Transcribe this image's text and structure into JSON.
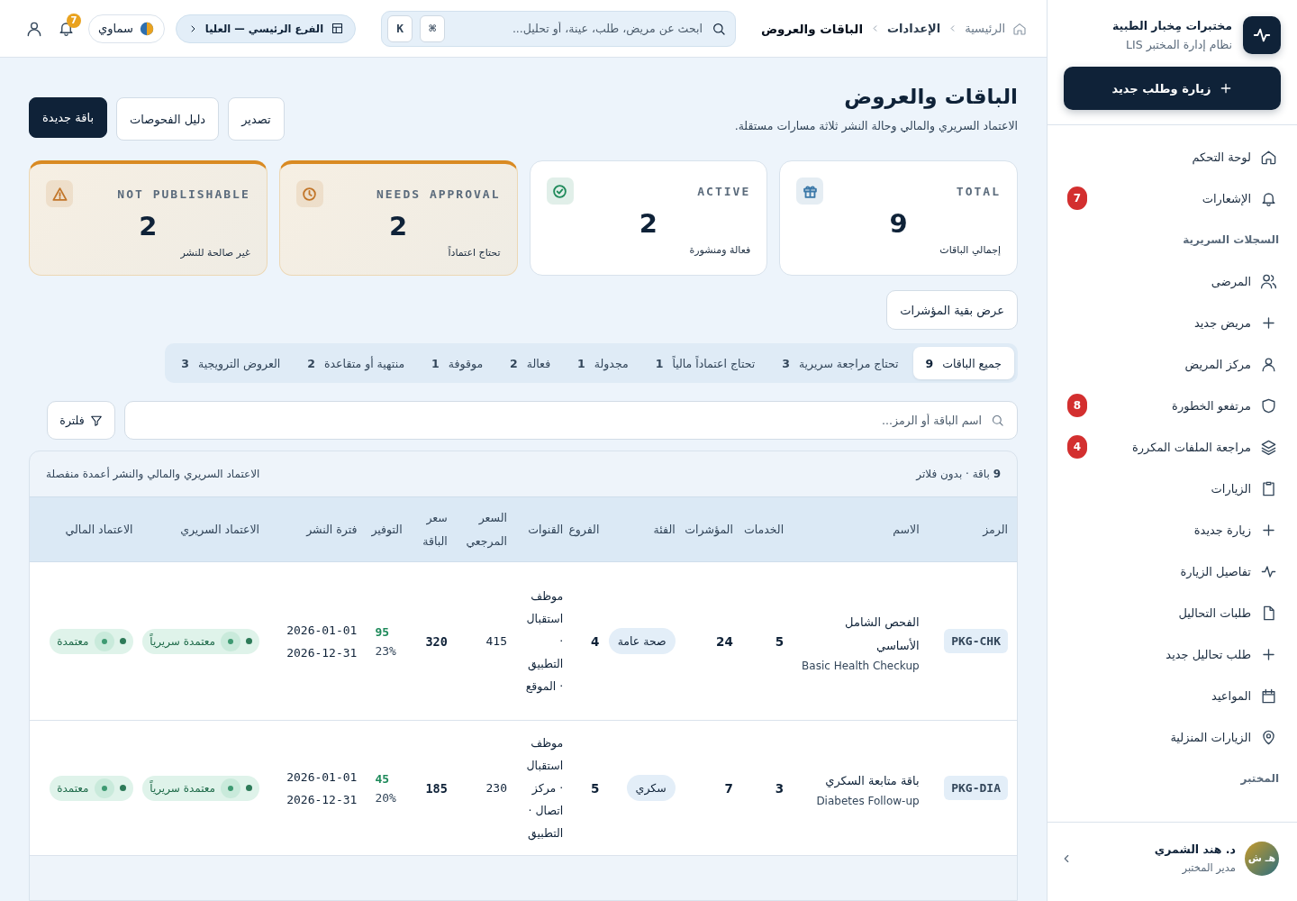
{
  "sidebar": {
    "brand": {
      "title": "مختبرات مِخبار الطبية",
      "subtitle": "نظام إدارة المختبر LIS"
    },
    "primary_button": "زيارة وطلب جديد",
    "items": [
      {
        "kind": "item",
        "label": "لوحة التحكم",
        "selected": false
      },
      {
        "kind": "item",
        "label": "الإشعارات",
        "selected": false,
        "badge": "7"
      },
      {
        "kind": "heading",
        "label": "السجلات السريرية"
      },
      {
        "kind": "item",
        "label": "المرضى",
        "selected": false
      },
      {
        "kind": "item",
        "label": "مريض جديد",
        "selected": false
      },
      {
        "kind": "item",
        "label": "مركز المريض",
        "selected": false
      },
      {
        "kind": "item",
        "label": "مرتفعو الخطورة",
        "selected": false,
        "badge": "8"
      },
      {
        "kind": "item",
        "label": "مراجعة الملفات المكررة",
        "selected": false,
        "badge": "4"
      },
      {
        "kind": "item",
        "label": "الزيارات",
        "selected": false
      },
      {
        "kind": "item",
        "label": "زيارة جديدة",
        "selected": false
      },
      {
        "kind": "item",
        "label": "تفاصيل الزيارة",
        "selected": false
      },
      {
        "kind": "item",
        "label": "طلبات التحاليل",
        "selected": false
      },
      {
        "kind": "item",
        "label": "طلب تحاليل جديد",
        "selected": false
      },
      {
        "kind": "item",
        "label": "المواعيد",
        "selected": false
      },
      {
        "kind": "item",
        "label": "الزيارات المنزلية",
        "selected": false
      },
      {
        "kind": "heading",
        "label": "المختبر"
      }
    ],
    "user": {
      "initials": "هـ ش",
      "name": "د. هند الشمري",
      "role": "مدير المختبر"
    }
  },
  "topbar": {
    "breadcrumb": [
      {
        "label": "الرئيسية",
        "current": false
      },
      {
        "label": "الإعدادات",
        "current": false
      },
      {
        "label": "الباقات والعروض",
        "current": true
      }
    ],
    "search": {
      "placeholder": "ابحث عن مريض، طلب، عينة، أو تحليل...",
      "keys": [
        "⌘",
        "K"
      ]
    },
    "branch": "الفرع الرئيسي — العليا",
    "theme": "سماوي",
    "notifications_badge": "7"
  },
  "page": {
    "title": "الباقات والعروض",
    "subtitle": "الاعتماد السريري والمالي وحالة النشر ثلاثة مسارات مستقلة.",
    "buttons": [
      {
        "label": "تصدير",
        "kind": "secondary"
      },
      {
        "label": "دليل الفحوصات",
        "kind": "secondary"
      },
      {
        "label": "باقة جديدة",
        "kind": "primary"
      }
    ]
  },
  "stats": [
    {
      "label": "TOTAL",
      "value": "9",
      "caption": "إجمالي الباقات",
      "kind": "plain",
      "color": "#3b78a8"
    },
    {
      "label": "ACTIVE",
      "value": "2",
      "caption": "فعالة ومنشورة",
      "kind": "plain",
      "color": "#1f8a5b"
    },
    {
      "label": "NEEDS APPROVAL",
      "value": "2",
      "caption": "تحتاج اعتماداً",
      "kind": "warning",
      "color": "#c2762a"
    },
    {
      "label": "NOT PUBLISHABLE",
      "value": "2",
      "caption": "غير صالحة للنشر",
      "kind": "warning",
      "color": "#c2762a"
    }
  ],
  "more_stats_button": "عرض بقية المؤشرات",
  "tabs": [
    {
      "label": "جميع الباقات",
      "count": "9",
      "selected": true
    },
    {
      "label": "تحتاج مراجعة سريرية",
      "count": "3",
      "selected": false
    },
    {
      "label": "تحتاج اعتماداً مالياً",
      "count": "1",
      "selected": false
    },
    {
      "label": "مجدولة",
      "count": "1",
      "selected": false
    },
    {
      "label": "فعالة",
      "count": "2",
      "selected": false
    },
    {
      "label": "موقوفة",
      "count": "1",
      "selected": false
    },
    {
      "label": "منتهية أو متقاعدة",
      "count": "2",
      "selected": false
    },
    {
      "label": "العروض الترويجية",
      "count": "3",
      "selected": false
    }
  ],
  "filter": {
    "placeholder": "اسم الباقة أو الرمز...",
    "button": "فلترة"
  },
  "table": {
    "summary": "**9** باقة · بدون فلاتر",
    "note": "الاعتماد السريري والمالي والنشر أعمدة منفصلة",
    "columns": [
      "الرمز",
      "الاسم",
      "الخدمات",
      "المؤشرات",
      "الفئة",
      "الفروع",
      "القنوات",
      "السعر المرجعي",
      "سعر الباقة",
      "التوفير",
      "فترة النشر",
      "الاعتماد السريري",
      "الاعتماد المالي"
    ],
    "rows": [
      {
        "code": "PKG-CHK",
        "name": "الفحص الشامل الأساسي",
        "name_en": "Basic Health Checkup",
        "services": "5",
        "indicators": "24",
        "category": "صحة عامة",
        "branches": "4",
        "channels": "موظف استقبال · التطبيق · الموقع",
        "reference_price": "415",
        "package_price": "320",
        "saving": "95",
        "saving_percent": "23%",
        "publish_from": "2026-01-01",
        "publish_to": "2026-12-31",
        "clinical_approval": "معتمدة سريرياً",
        "financial_approval": "معتمدة"
      },
      {
        "code": "PKG-DIA",
        "name": "باقة متابعة السكري",
        "name_en": "Diabetes Follow-up",
        "services": "3",
        "indicators": "7",
        "category": "سكري",
        "branches": "5",
        "channels": "موظف استقبال · مركز اتصال · التطبيق",
        "reference_price": "230",
        "package_price": "185",
        "saving": "45",
        "saving_percent": "20%",
        "publish_from": "2026-01-01",
        "publish_to": "2026-12-31",
        "clinical_approval": "معتمدة سريرياً",
        "financial_approval": "معتمدة"
      }
    ]
  }
}
